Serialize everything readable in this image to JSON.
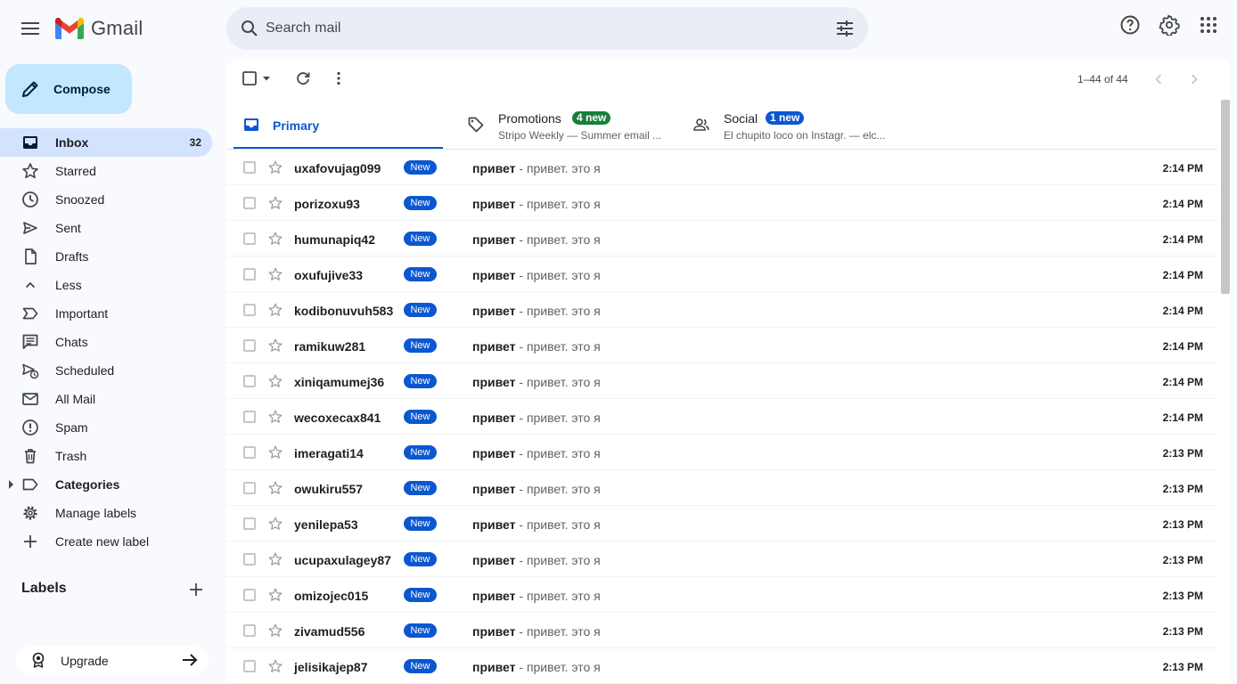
{
  "app": {
    "name": "Gmail"
  },
  "search": {
    "placeholder": "Search mail"
  },
  "compose": {
    "label": "Compose"
  },
  "sidebar": {
    "items": [
      {
        "id": "inbox",
        "label": "Inbox",
        "count": "32",
        "icon": "inbox-icon",
        "active": true
      },
      {
        "id": "starred",
        "label": "Starred",
        "icon": "star-icon"
      },
      {
        "id": "snoozed",
        "label": "Snoozed",
        "icon": "clock-icon"
      },
      {
        "id": "sent",
        "label": "Sent",
        "icon": "send-icon"
      },
      {
        "id": "drafts",
        "label": "Drafts",
        "icon": "draft-icon"
      },
      {
        "id": "less",
        "label": "Less",
        "icon": "chevron-up-icon"
      },
      {
        "id": "important",
        "label": "Important",
        "icon": "label-important-icon"
      },
      {
        "id": "chats",
        "label": "Chats",
        "icon": "chat-icon"
      },
      {
        "id": "scheduled",
        "label": "Scheduled",
        "icon": "scheduled-send-icon"
      },
      {
        "id": "all-mail",
        "label": "All Mail",
        "icon": "all-mail-icon"
      },
      {
        "id": "spam",
        "label": "Spam",
        "icon": "spam-icon"
      },
      {
        "id": "trash",
        "label": "Trash",
        "icon": "trash-icon"
      },
      {
        "id": "categories",
        "label": "Categories",
        "icon": "label-icon"
      },
      {
        "id": "manage-labels",
        "label": "Manage labels",
        "icon": "gear-icon"
      },
      {
        "id": "create-label",
        "label": "Create new label",
        "icon": "plus-icon"
      }
    ],
    "labels_heading": "Labels",
    "upgrade_label": "Upgrade"
  },
  "toolbar": {
    "pagination": "1–44 of 44"
  },
  "tabs": [
    {
      "id": "primary",
      "title": "Primary"
    },
    {
      "id": "promotions",
      "title": "Promotions",
      "badge": "4 new",
      "badge_color": "#188038",
      "snippet": "Stripo Weekly — Summer email ..."
    },
    {
      "id": "social",
      "title": "Social",
      "badge": "1 new",
      "badge_color": "#0b57d0",
      "snippet": "El chupito loco on Instagr. — elc..."
    }
  ],
  "emails": [
    {
      "sender": "uxafovujag099",
      "badge": "New",
      "subject": "привет",
      "snippet": " - привет. это я",
      "time": "2:14 PM"
    },
    {
      "sender": "porizoxu93",
      "badge": "New",
      "subject": "привет",
      "snippet": " - привет. это я",
      "time": "2:14 PM"
    },
    {
      "sender": "humunapiq42",
      "badge": "New",
      "subject": "привет",
      "snippet": " - привет. это я",
      "time": "2:14 PM"
    },
    {
      "sender": "oxufujive33",
      "badge": "New",
      "subject": "привет",
      "snippet": " - привет. это я",
      "time": "2:14 PM"
    },
    {
      "sender": "kodibonuvuh583",
      "badge": "New",
      "subject": "привет",
      "snippet": " - привет. это я",
      "time": "2:14 PM"
    },
    {
      "sender": "ramikuw281",
      "badge": "New",
      "subject": "привет",
      "snippet": " - привет. это я",
      "time": "2:14 PM"
    },
    {
      "sender": "xiniqamumej36",
      "badge": "New",
      "subject": "привет",
      "snippet": " - привет. это я",
      "time": "2:14 PM"
    },
    {
      "sender": "wecoxecax841",
      "badge": "New",
      "subject": "привет",
      "snippet": " - привет. это я",
      "time": "2:14 PM"
    },
    {
      "sender": "imeragati14",
      "badge": "New",
      "subject": "привет",
      "snippet": " - привет. это я",
      "time": "2:13 PM"
    },
    {
      "sender": "owukiru557",
      "badge": "New",
      "subject": "привет",
      "snippet": " - привет. это я",
      "time": "2:13 PM"
    },
    {
      "sender": "yenilepa53",
      "badge": "New",
      "subject": "привет",
      "snippet": " - привет. это я",
      "time": "2:13 PM"
    },
    {
      "sender": "ucupaxulagey87",
      "badge": "New",
      "subject": "привет",
      "snippet": " - привет. это я",
      "time": "2:13 PM"
    },
    {
      "sender": "omizojec015",
      "badge": "New",
      "subject": "привет",
      "snippet": " - привет. это я",
      "time": "2:13 PM"
    },
    {
      "sender": "zivamud556",
      "badge": "New",
      "subject": "привет",
      "snippet": " - привет. это я",
      "time": "2:13 PM"
    },
    {
      "sender": "jelisikajep87",
      "badge": "New",
      "subject": "привет",
      "snippet": " - привет. это я",
      "time": "2:13 PM"
    }
  ]
}
